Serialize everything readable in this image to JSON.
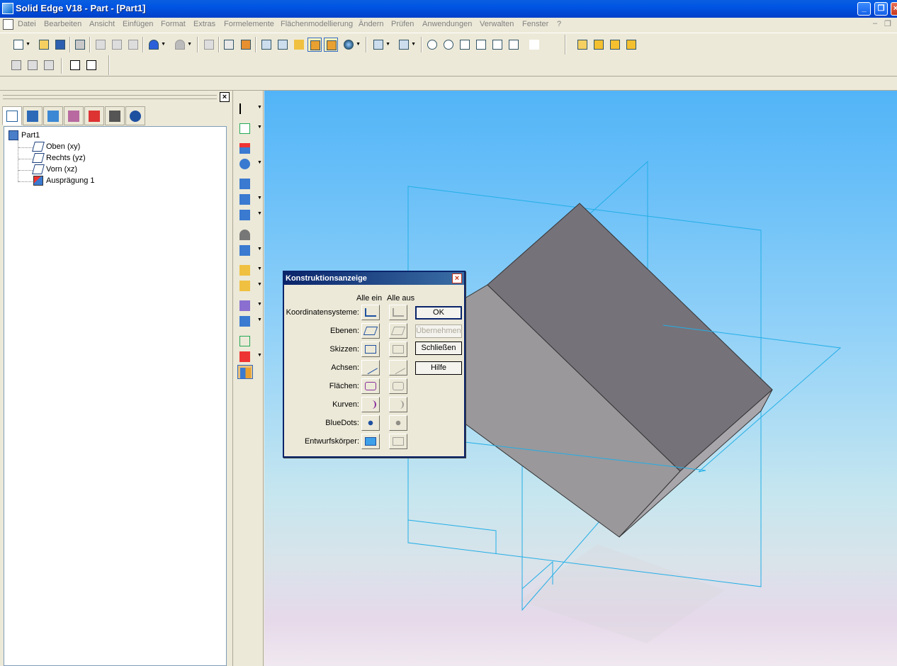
{
  "window": {
    "title": "Solid Edge V18 - Part - [Part1]"
  },
  "menu": {
    "items": [
      "Datei",
      "Bearbeiten",
      "Ansicht",
      "Einfügen",
      "Format",
      "Extras",
      "Formelemente",
      "Flächenmodellierung",
      "Ändern",
      "Prüfen",
      "Anwendungen",
      "Verwalten",
      "Fenster",
      "?"
    ]
  },
  "toolbar_icons": [
    "new-icon",
    "open-icon",
    "save-icon",
    "print-icon",
    "cut-icon",
    "copy-icon",
    "paste-icon",
    "undo-icon",
    "redo-icon",
    "select-icon",
    "highlight-icon",
    "cube-view-icon",
    "cube-view2-icon",
    "shaded-icon",
    "visible-edges-icon",
    "shaded-edges-icon",
    "sphere-icon",
    "view-orient-icon",
    "fit-icon",
    "zoom-area-icon",
    "zoom-icon",
    "fit-all-icon",
    "pan-icon",
    "rotate-icon",
    "spin-icon",
    "help-pointer-icon",
    "measure-icon",
    "measure2-icon",
    "measure3-icon"
  ],
  "tree": {
    "root": "Part1",
    "children": [
      "Oben (xy)",
      "Rechts (yz)",
      "Vorn (xz)",
      "Ausprägung 1"
    ]
  },
  "dialog": {
    "title": "Konstruktionsanzeige",
    "col_all_on": "Alle ein",
    "col_all_off": "Alle aus",
    "rows": [
      "Koordinatensysteme:",
      "Ebenen:",
      "Skizzen:",
      "Achsen:",
      "Flächen:",
      "Kurven:",
      "BlueDots:",
      "Entwurfskörper:"
    ],
    "buttons": {
      "ok": "OK",
      "apply": "Übernehmen",
      "close": "Schließen",
      "help": "Hilfe"
    }
  },
  "colors": {
    "titlebar": "#0054e3",
    "viewport_top": "#52b4f7",
    "solid_top": "#76727a",
    "solid_side": "#9a989b",
    "plane_line": "#22aee6"
  }
}
